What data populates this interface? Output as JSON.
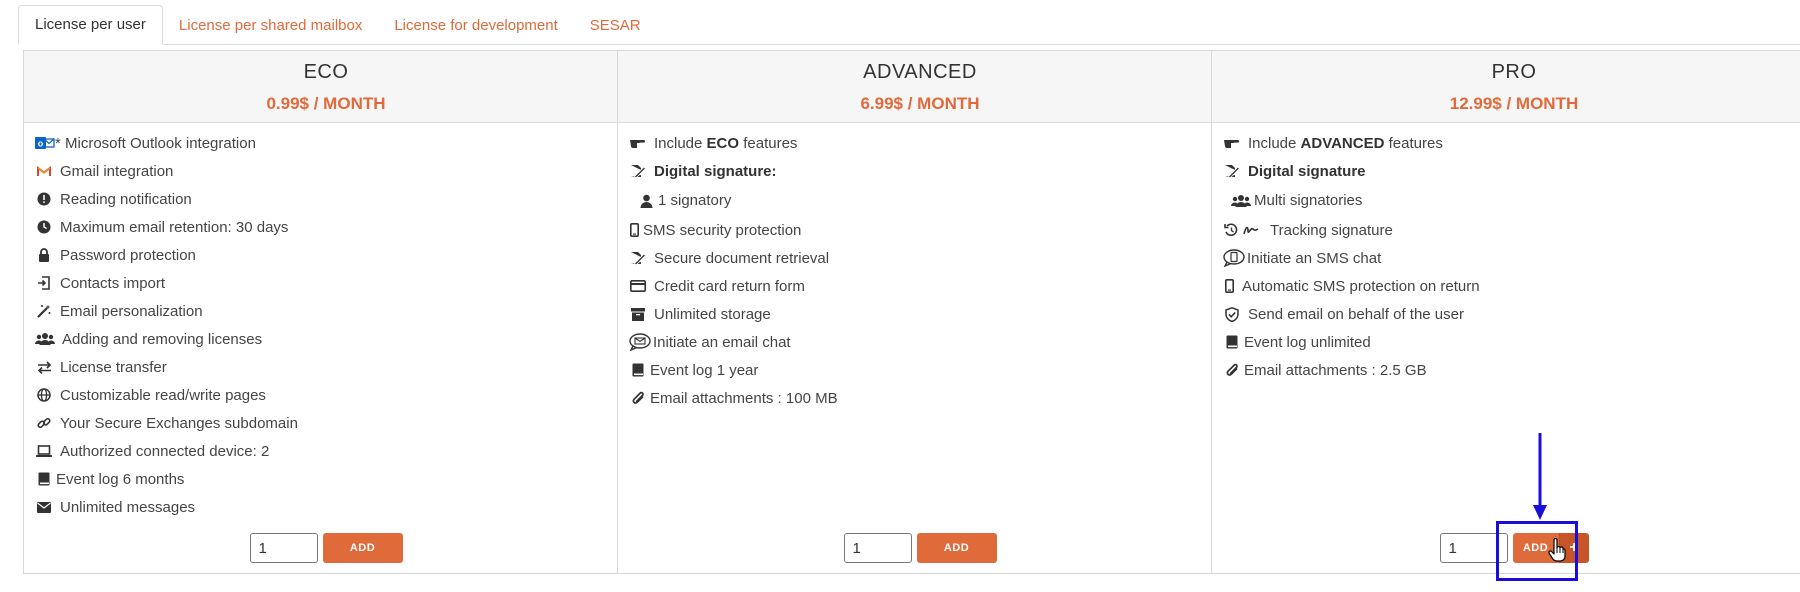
{
  "tabs": [
    {
      "label": "License per user",
      "active": true
    },
    {
      "label": "License per shared mailbox",
      "active": false
    },
    {
      "label": "License for development",
      "active": false
    },
    {
      "label": "SESAR",
      "active": false
    }
  ],
  "colors": {
    "accent": "#df6a3a",
    "annotation": "#1a0fd8"
  },
  "plans": [
    {
      "title": "ECO",
      "price": "0.99$ / MONTH",
      "features": [
        {
          "icon": "outlook-icon",
          "text": "* Microsoft Outlook integration"
        },
        {
          "icon": "gmail-icon",
          "text": "Gmail integration"
        },
        {
          "icon": "exclamation-circle-icon",
          "text": "Reading notification"
        },
        {
          "icon": "clock-icon",
          "text": "Maximum email retention: 30 days"
        },
        {
          "icon": "lock-icon",
          "text": "Password protection"
        },
        {
          "icon": "import-icon",
          "text": "Contacts import"
        },
        {
          "icon": "magic-wand-icon",
          "text": "Email personalization"
        },
        {
          "icon": "users-icon",
          "text": "Adding and removing licenses"
        },
        {
          "icon": "exchange-icon",
          "text": "License transfer"
        },
        {
          "icon": "globe-icon",
          "text": "Customizable read/write pages"
        },
        {
          "icon": "link-icon",
          "text": "Your Secure Exchanges subdomain"
        },
        {
          "icon": "laptop-icon",
          "text": "Authorized connected device: 2"
        },
        {
          "icon": "book-icon",
          "text": "Event log 6 months"
        },
        {
          "icon": "envelope-icon",
          "text": "Unlimited messages"
        }
      ],
      "quantity": "1",
      "add_label": "ADD"
    },
    {
      "title": "ADVANCED",
      "price": "6.99$ / MONTH",
      "include_prefix": "Include",
      "include_bold": "ECO",
      "include_suffix": "features",
      "signature_label": "Digital signature:",
      "signatory_label": "1 signatory",
      "features": [
        {
          "icon": "mobile-icon",
          "text": "SMS security protection"
        },
        {
          "icon": "file-signature-icon",
          "text": "Secure document retrieval"
        },
        {
          "icon": "credit-card-icon",
          "text": "Credit card return form"
        },
        {
          "icon": "archive-icon",
          "text": "Unlimited storage"
        },
        {
          "icon": "email-chat-icon",
          "text": "Initiate an email chat"
        },
        {
          "icon": "book-icon",
          "text": "Event log 1 year"
        },
        {
          "icon": "paperclip-icon",
          "text": "Email attachments : 100 MB"
        }
      ],
      "quantity": "1",
      "add_label": "ADD"
    },
    {
      "title": "PRO",
      "price": "12.99$ / MONTH",
      "include_prefix": "Include",
      "include_bold": "ADVANCED",
      "include_suffix": "features",
      "signature_label": "Digital signature",
      "signatory_label": "Multi signatories",
      "features": [
        {
          "icon": "tracking-signature-icon",
          "text": "Tracking signature"
        },
        {
          "icon": "sms-chat-icon",
          "text": "Initiate an SMS chat"
        },
        {
          "icon": "mobile-icon",
          "text": "Automatic SMS protection on return"
        },
        {
          "icon": "shield-icon",
          "text": "Send email on behalf of the user"
        },
        {
          "icon": "book-icon",
          "text": "Event log unlimited"
        },
        {
          "icon": "paperclip-icon",
          "text": "Email attachments : 2.5 GB"
        }
      ],
      "quantity": "1",
      "add_label": "ADD",
      "plus_label": "+"
    }
  ]
}
